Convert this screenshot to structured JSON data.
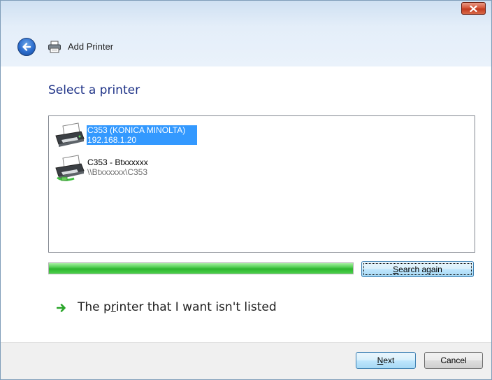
{
  "window": {
    "title": "Add Printer",
    "close_icon": "close-icon",
    "back_icon": "back-arrow-icon",
    "title_icon": "printer-icon"
  },
  "main": {
    "heading": "Select a printer",
    "printers": [
      {
        "name": "C353 (KONICA MINOLTA)",
        "detail": "192.168.1.20",
        "selected": true,
        "icon": "network-printer-icon"
      },
      {
        "name": "C353 - Btxxxxxx",
        "detail": "\\\\Btxxxxxx\\C353",
        "selected": false,
        "icon": "shared-printer-icon"
      }
    ],
    "search_progress": 1.0,
    "search_again_prefix": "",
    "search_again_access": "S",
    "search_again_suffix": "earch again",
    "link_prefix": "The p",
    "link_access": "r",
    "link_suffix": "inter that I want isn't listed",
    "link_icon": "green-arrow-icon"
  },
  "footer": {
    "next_access": "N",
    "next_suffix": "ext",
    "cancel_label": "Cancel"
  },
  "colors": {
    "heading": "#1e3287",
    "selection": "#3399ff",
    "progress": "#2fb52f",
    "close_button": "#c23a1f"
  }
}
